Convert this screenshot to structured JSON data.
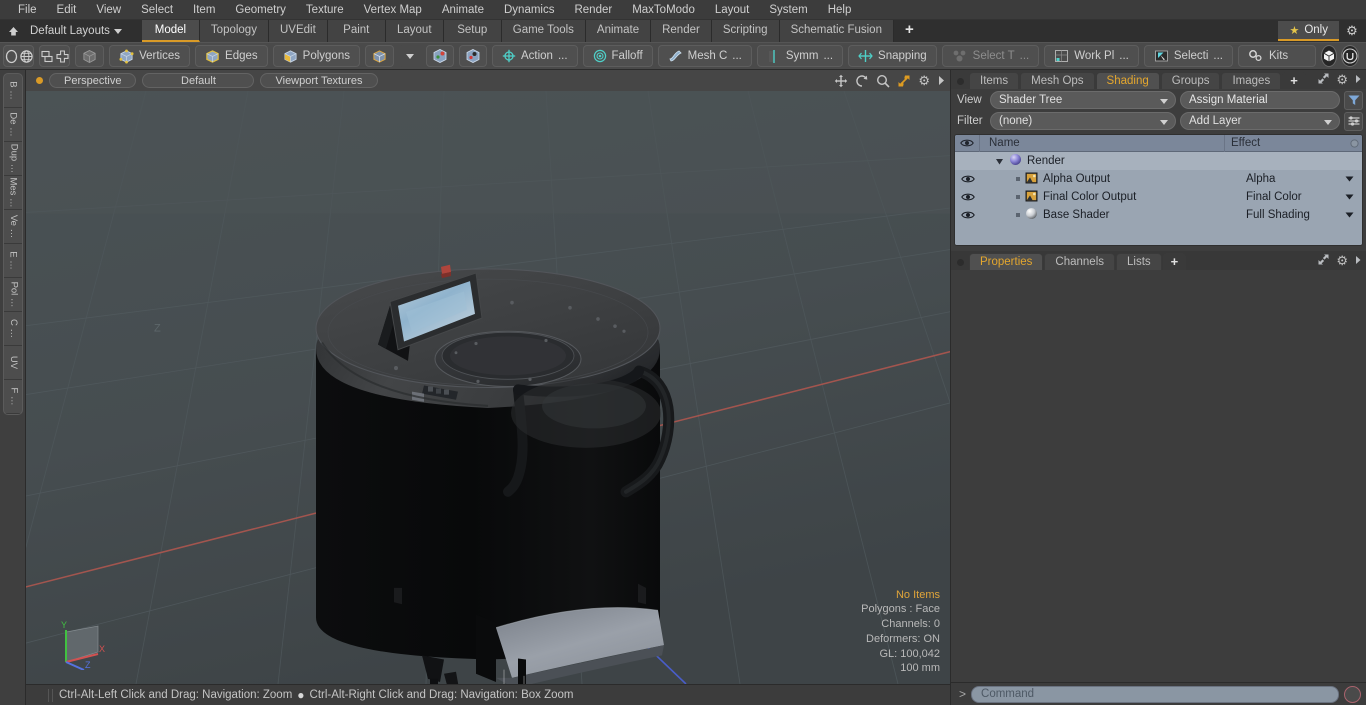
{
  "app": {
    "title": "Modo",
    "accent_orange": "#d99a27",
    "panel_bg": "#3d3d3d",
    "toolbar_bg": "#4a4a4a",
    "viewport_bg": "#454c4f",
    "tree_bg": "#9aa5b2"
  },
  "menubar": {
    "items": [
      {
        "label": "File"
      },
      {
        "label": "Edit"
      },
      {
        "label": "View"
      },
      {
        "label": "Select"
      },
      {
        "label": "Item"
      },
      {
        "label": "Geometry"
      },
      {
        "label": "Texture"
      },
      {
        "label": "Vertex Map"
      },
      {
        "label": "Animate"
      },
      {
        "label": "Dynamics"
      },
      {
        "label": "Render"
      },
      {
        "label": "MaxToModo"
      },
      {
        "label": "Layout"
      },
      {
        "label": "System"
      },
      {
        "label": "Help"
      }
    ]
  },
  "layout_row": {
    "home_icon": "home-up-icon",
    "layout_selector": "Default Layouts",
    "tabs": [
      {
        "label": "Model",
        "active": true
      },
      {
        "label": "Topology",
        "active": false
      },
      {
        "label": "UVEdit",
        "active": false
      },
      {
        "label": "Paint",
        "active": false
      },
      {
        "label": "Layout",
        "active": false
      },
      {
        "label": "Setup",
        "active": false
      },
      {
        "label": "Game Tools",
        "active": false
      },
      {
        "label": "Animate",
        "active": false
      },
      {
        "label": "Render",
        "active": false
      },
      {
        "label": "Scripting",
        "active": false
      },
      {
        "label": "Schematic Fusion",
        "active": false
      }
    ],
    "add_tab": "+",
    "only_button": "Only",
    "only_icon": "star-icon",
    "settings_icon": "gear-icon"
  },
  "main_toolbar": {
    "shape_tools": [
      {
        "name": "ellipse-tool-icon"
      },
      {
        "name": "globe-tool-icon"
      },
      {
        "name": "pen-tool-icon"
      },
      {
        "name": "paint-tool-icon"
      }
    ],
    "mode_tools": [
      {
        "name": "mirror-tool-icon"
      },
      {
        "name": "axis-tool-icon"
      },
      {
        "name": "center-tool-icon"
      },
      {
        "name": "radial-tool-icon"
      }
    ],
    "selection_modes": [
      {
        "label": "",
        "name": "items-mode-icon"
      },
      {
        "label": "Vertices",
        "name": "vertices-mode-icon"
      },
      {
        "label": "Edges",
        "name": "edges-mode-icon"
      },
      {
        "label": "Polygons",
        "name": "polygons-mode-icon"
      },
      {
        "label": "",
        "name": "materials-mode-icon"
      }
    ],
    "buttons": [
      {
        "label": "Action",
        "suffix": "...",
        "name": "action-center-button",
        "icon": "crosshair-icon"
      },
      {
        "label": "Falloff",
        "suffix": "",
        "name": "falloff-button",
        "icon": "target-icon"
      },
      {
        "label": "Mesh C",
        "suffix": "...",
        "name": "mesh-constraint-button",
        "icon": "mesh-icon"
      },
      {
        "label": "Symm",
        "suffix": "...",
        "name": "symmetry-button",
        "icon": "symmetry-icon"
      },
      {
        "label": "Snapping",
        "suffix": "",
        "name": "snapping-button",
        "icon": "snap-icon"
      },
      {
        "label": "Select T",
        "suffix": "...",
        "name": "select-through-button",
        "icon": "select-through-icon",
        "dim": true
      },
      {
        "label": "Work Pl",
        "suffix": "...",
        "name": "work-plane-button",
        "icon": "workplane-icon"
      },
      {
        "label": "Selecti",
        "suffix": "...",
        "name": "selection-sets-button",
        "icon": "selection-icon"
      },
      {
        "label": "Kits",
        "suffix": "",
        "name": "kits-button",
        "icon": "kits-gears-icon"
      }
    ],
    "right_round_buttons": [
      {
        "name": "substance-icon"
      },
      {
        "name": "unreal-engine-icon"
      }
    ]
  },
  "left_strip": {
    "tabs": [
      {
        "label": "B …",
        "name": "sidebar-tab-basic"
      },
      {
        "label": "De …",
        "name": "sidebar-tab-deform"
      },
      {
        "label": "Dup …",
        "name": "sidebar-tab-duplicate"
      },
      {
        "label": "Mes …",
        "name": "sidebar-tab-mesh"
      },
      {
        "label": "Ve …",
        "name": "sidebar-tab-vertex"
      },
      {
        "label": "E …",
        "name": "sidebar-tab-edge"
      },
      {
        "label": "Pol …",
        "name": "sidebar-tab-polygon"
      },
      {
        "label": "C …",
        "name": "sidebar-tab-curve"
      },
      {
        "label": "UV",
        "name": "sidebar-tab-uv"
      },
      {
        "label": "F …",
        "name": "sidebar-tab-falloff"
      }
    ]
  },
  "viewport": {
    "header": {
      "view_type": "Perspective",
      "shading_style": "Default",
      "display_mode": "Viewport Textures",
      "tools": [
        {
          "name": "pan-icon"
        },
        {
          "name": "rotate-icon"
        },
        {
          "name": "zoom-icon"
        },
        {
          "name": "fit-icon"
        },
        {
          "name": "gear-icon"
        },
        {
          "name": "chevron-right-icon"
        }
      ]
    },
    "stats": {
      "items": "No Items",
      "polygons": "Polygons : Face",
      "channels": "Channels: 0",
      "deformers": "Deformers: ON",
      "gl": "GL: 100,042",
      "scale": "100 mm"
    },
    "axis_gizmo": {
      "y_label": "Y",
      "x_label": "X",
      "z_label": "Z",
      "y_color": "#41c141",
      "x_color": "#d15151",
      "z_color": "#5572e0"
    },
    "grid_axis_labels": {
      "left_label": "Z"
    },
    "model_description": "dark cylindrical autonomous service robot with top touchscreen display, lid hatch, side handle and front ramp panel"
  },
  "status_bar": {
    "left_hint": "Ctrl-Alt-Left Click and Drag: Navigation: Zoom",
    "separator": "●",
    "right_hint": "Ctrl-Alt-Right Click and Drag: Navigation: Box Zoom"
  },
  "right_panel": {
    "tabs": [
      {
        "label": "Items",
        "active": false
      },
      {
        "label": "Mesh Ops",
        "active": false
      },
      {
        "label": "Shading",
        "active": true
      },
      {
        "label": "Groups",
        "active": false
      },
      {
        "label": "Images",
        "active": false
      }
    ],
    "add_tab": "+",
    "header_icons": [
      {
        "name": "expand-icon"
      },
      {
        "name": "gear-icon"
      },
      {
        "name": "chevron-right-icon"
      }
    ],
    "controls": {
      "view_label": "View",
      "view_value": "Shader Tree",
      "assign_material": "Assign Material",
      "filter_label": "Filter",
      "filter_value": "(none)",
      "add_layer": "Add Layer",
      "filter_icon": "funnel-icon",
      "options_icon": "sliders-icon"
    },
    "tree": {
      "columns": {
        "visibility": "eye-icon",
        "name": "Name",
        "effect": "Effect"
      },
      "rows": [
        {
          "name": "Render",
          "effect": "",
          "icon": "render-sphere-icon",
          "depth": 0,
          "selected": true,
          "has_eye": false,
          "expanded": true
        },
        {
          "name": "Alpha Output",
          "effect": "Alpha",
          "icon": "image-output-icon",
          "depth": 1,
          "selected": false,
          "has_eye": true
        },
        {
          "name": "Final Color Output",
          "effect": "Final Color",
          "icon": "image-output-icon",
          "depth": 1,
          "selected": false,
          "has_eye": true
        },
        {
          "name": "Base Shader",
          "effect": "Full Shading",
          "icon": "shader-sphere-icon",
          "depth": 1,
          "selected": false,
          "has_eye": true
        }
      ]
    },
    "lower_tabs": [
      {
        "label": "Properties",
        "active": true
      },
      {
        "label": "Channels",
        "active": false
      },
      {
        "label": "Lists",
        "active": false
      }
    ],
    "lower_add_tab": "+",
    "lower_header_icons": [
      {
        "name": "expand-icon"
      },
      {
        "name": "gear-icon"
      },
      {
        "name": "chevron-right-icon"
      }
    ]
  },
  "command_bar": {
    "prompt": ">",
    "placeholder": "Command",
    "record_icon": "record-circle-icon"
  }
}
